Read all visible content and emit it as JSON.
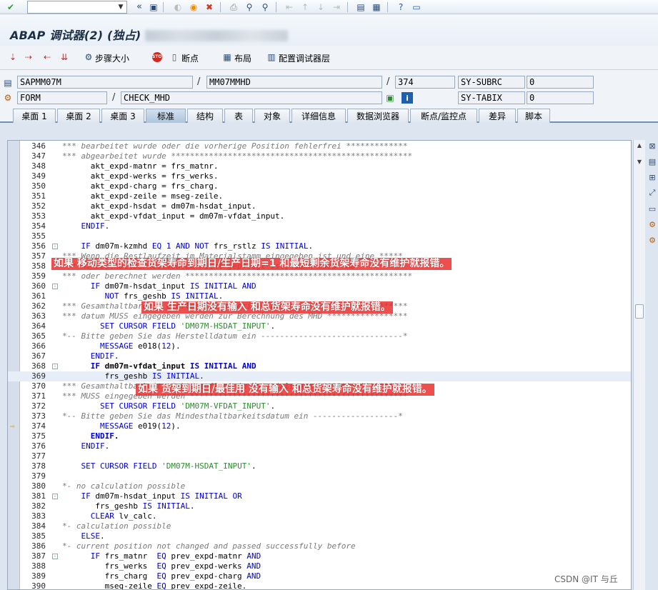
{
  "window": {
    "title": "ABAP 调试器(2) (独占)",
    "title_redacted": "(SandBoxAP_SER_00)"
  },
  "systembar": {
    "command_field_value": "",
    "icons": [
      "check-icon",
      "back-icon",
      "save-icon",
      "exit-icon",
      "cancel-icon",
      "print-icon",
      "find-icon",
      "find-next-icon",
      "first-page-icon",
      "prev-page-icon",
      "next-page-icon",
      "last-page-icon",
      "new-session-icon",
      "shortcut-icon",
      "help-icon",
      "customize-icon"
    ]
  },
  "app_toolbar": {
    "step_size": "步骤大小",
    "breakpoint": "断点",
    "layout": "布局",
    "configure": "配置调试器层"
  },
  "info": {
    "program": "SAPMM07M",
    "include": "MM07MMHD",
    "line": "374",
    "event_type": "FORM",
    "event_name": "CHECK_MHD",
    "var1_name": "SY-SUBRC",
    "var1_value": "0",
    "var2_name": "SY-TABIX",
    "var2_value": "0"
  },
  "tabs": [
    {
      "label": "桌面 1"
    },
    {
      "label": "桌面 2"
    },
    {
      "label": "桌面 3"
    },
    {
      "label": "标准"
    },
    {
      "label": "结构"
    },
    {
      "label": "表"
    },
    {
      "label": "对象"
    },
    {
      "label": "详细信息"
    },
    {
      "label": "数据浏览器"
    },
    {
      "label": "断点/监控点"
    },
    {
      "label": "差异"
    },
    {
      "label": "脚本"
    }
  ],
  "code_lines": [
    {
      "n": "346",
      "t": "*** bearbeitet wurde oder die vorherige Position fehlerfrei *************"
    },
    {
      "n": "347",
      "t": "*** abgearbeitet wurde ***************************************************"
    },
    {
      "n": "348",
      "t": "      akt_expd-matnr = frs_matnr."
    },
    {
      "n": "349",
      "t": "      akt_expd-werks = frs_werks."
    },
    {
      "n": "350",
      "t": "      akt_expd-charg = frs_charg."
    },
    {
      "n": "351",
      "t": "      akt_expd-zeile = mseg-zeile."
    },
    {
      "n": "352",
      "t": "      akt_expd-hsdat = dm07m-hsdat_input."
    },
    {
      "n": "353",
      "t": "      akt_expd-vfdat_input = dm07m-vfdat_input."
    },
    {
      "n": "354",
      "t": "    ENDIF."
    },
    {
      "n": "355",
      "t": ""
    },
    {
      "n": "356",
      "t": "    IF dm07m-kzmhd EQ 1 AND NOT frs_rstlz IS INITIAL."
    },
    {
      "n": "357",
      "t": "*** Wenn die Restlaufzeit im Materialstamm eingegeben ist und eine *****"
    },
    {
      "n": "358",
      "t": "*** Mindesthaltbarkeitsdatum nicht gepflegt ist, dann muss MHD *********"
    },
    {
      "n": "359",
      "t": "*** oder berechnet werden ************************************************"
    },
    {
      "n": "360",
      "t": "      IF dm07m-hsdat_input IS INITIAL AND"
    },
    {
      "n": "361",
      "t": "         NOT frs_geshb IS INITIAL."
    },
    {
      "n": "362",
      "t": "*** Gesamthaltbarkeit gepflegt im Materialstamm *************************"
    },
    {
      "n": "363",
      "t": "*** datum MUSS eingegeben werden zur Berechnung des MHD *****************"
    },
    {
      "n": "364",
      "t": "        SET CURSOR FIELD 'DM07M-HSDAT_INPUT'."
    },
    {
      "n": "365",
      "t": "*-- Bitte geben Sie das Herstelldatum ein ------------------------------*"
    },
    {
      "n": "366",
      "t": "        MESSAGE e018(12)."
    },
    {
      "n": "367",
      "t": "      ENDIF."
    },
    {
      "n": "368",
      "t": "      IF dm07m-vfdat_input IS INITIAL AND"
    },
    {
      "n": "369",
      "t": "         frs_geshb IS INITIAL."
    },
    {
      "n": "370",
      "t": "*** Gesamthaltbarkeit nicht gepflegt im Materialstamm ******************"
    },
    {
      "n": "371",
      "t": "*** MUSS eingegeben werden **********************************************"
    },
    {
      "n": "372",
      "t": "        SET CURSOR FIELD 'DM07M-VFDAT_INPUT'."
    },
    {
      "n": "373",
      "t": "*-- Bitte geben Sie das Mindesthaltbarkeitsdatum ein ------------------*"
    },
    {
      "n": "374",
      "t": "        MESSAGE e019(12)."
    },
    {
      "n": "375",
      "t": "      ENDIF."
    },
    {
      "n": "376",
      "t": "    ENDIF."
    },
    {
      "n": "377",
      "t": ""
    },
    {
      "n": "378",
      "t": "    SET CURSOR FIELD 'DM07M-HSDAT_INPUT'."
    },
    {
      "n": "379",
      "t": ""
    },
    {
      "n": "380",
      "t": "*- no calculation possible"
    },
    {
      "n": "381",
      "t": "    IF dm07m-hsdat_input IS INITIAL OR"
    },
    {
      "n": "382",
      "t": "       frs_geshb IS INITIAL."
    },
    {
      "n": "383",
      "t": "      CLEAR lv_calc."
    },
    {
      "n": "384",
      "t": "*- calculation possible"
    },
    {
      "n": "385",
      "t": "    ELSE."
    },
    {
      "n": "386",
      "t": "*- current position not changed and passed successfully before"
    },
    {
      "n": "387",
      "t": "      IF frs_matnr  EQ prev_expd-matnr AND"
    },
    {
      "n": "388",
      "t": "         frs_werks  EQ prev_expd-werks AND"
    },
    {
      "n": "389",
      "t": "         frs_charg  EQ prev_expd-charg AND"
    },
    {
      "n": "390",
      "t": "         mseg-zeile EQ prev_expd-zeile."
    }
  ],
  "annotations": [
    {
      "text": "如果 移动类型的检查货架寿命到期日/生产日期=1  和最短剩余货架寿命没有维护就报错。"
    },
    {
      "text": "如果 生产日期没有输入  和总货架寿命没有维护就报错。"
    },
    {
      "text": "如果  货架到期日/最佳用 没有输入  和总货架寿命没有维护就报错。"
    }
  ],
  "watermark": "CSDN @IT 与丘"
}
